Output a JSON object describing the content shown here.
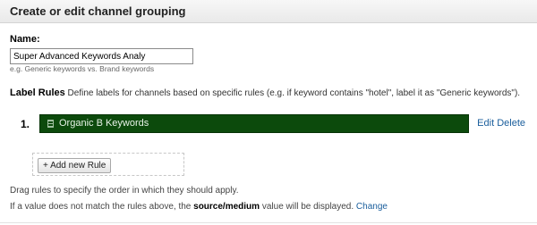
{
  "header": {
    "title": "Create or edit channel grouping"
  },
  "name_section": {
    "label": "Name:",
    "value": "Super Advanced Keywords Analy",
    "hint": "e.g. Generic keywords vs. Brand keywords"
  },
  "label_rules": {
    "title": "Label Rules",
    "description": "Define labels for channels based on specific rules (e.g. if keyword contains \"hotel\", label it as \"Generic keywords\").",
    "rules": [
      {
        "number": "1.",
        "label": "Organic B Keywords",
        "edit": "Edit",
        "delete": "Delete"
      }
    ],
    "add_button": "+ Add new Rule"
  },
  "notes": {
    "drag": "Drag rules to specify the order in which they should apply.",
    "fallback_prefix": "If a value does not match the rules above, the",
    "fallback_bold": "source/medium",
    "fallback_suffix": "value will be displayed.",
    "change_link": "Change"
  },
  "colors": {
    "rule_bar": "#0c4a0c",
    "link": "#1a5e9c"
  },
  "icons": {
    "rule_handle": "drag-handle-icon"
  }
}
